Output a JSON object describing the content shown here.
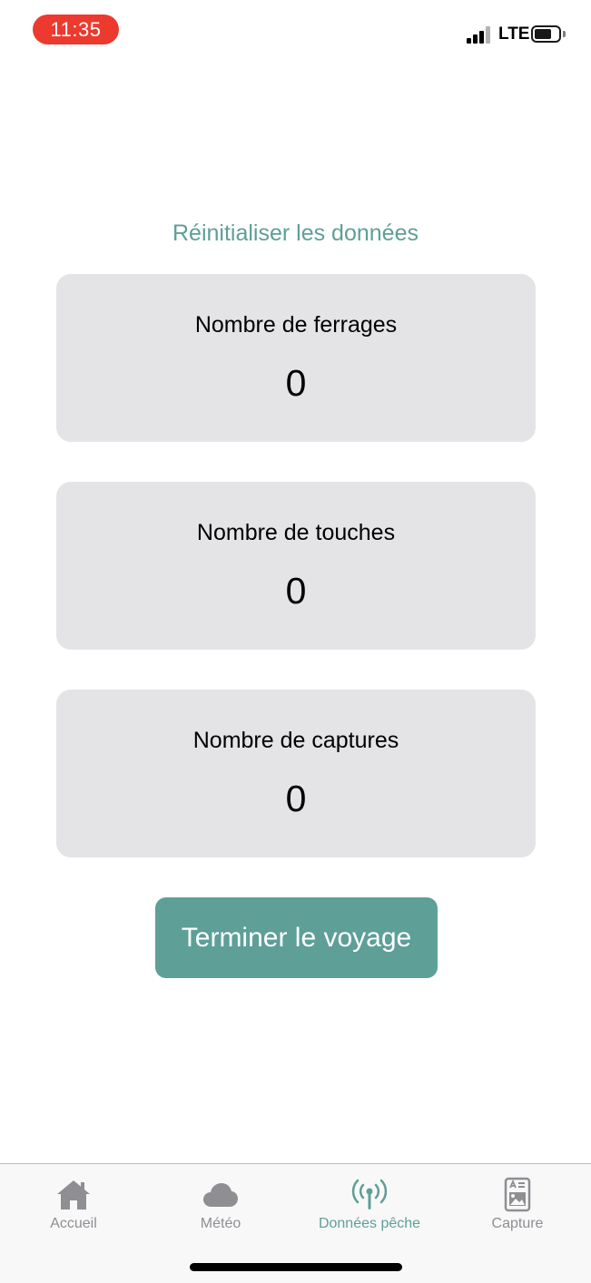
{
  "status_bar": {
    "time": "11:35",
    "network": "LTE",
    "time_pill_color": "#ec3a2e"
  },
  "main": {
    "reset_link": "Réinitialiser les données",
    "cards": [
      {
        "label": "Nombre de ferrages",
        "value": "0"
      },
      {
        "label": "Nombre de touches",
        "value": "0"
      },
      {
        "label": "Nombre de captures",
        "value": "0"
      }
    ],
    "end_button_label": "Terminer le voyage"
  },
  "tab_bar": {
    "active_index": 2,
    "items": [
      {
        "label": "Accueil",
        "icon": "house-icon"
      },
      {
        "label": "Météo",
        "icon": "cloud-icon"
      },
      {
        "label": "Données pêche",
        "icon": "antenna-icon"
      },
      {
        "label": "Capture",
        "icon": "photo-card-icon"
      }
    ]
  },
  "colors": {
    "accent": "#5e9f98",
    "card_background": "#e4e3e6",
    "inactive_tab": "#8e8e93"
  }
}
